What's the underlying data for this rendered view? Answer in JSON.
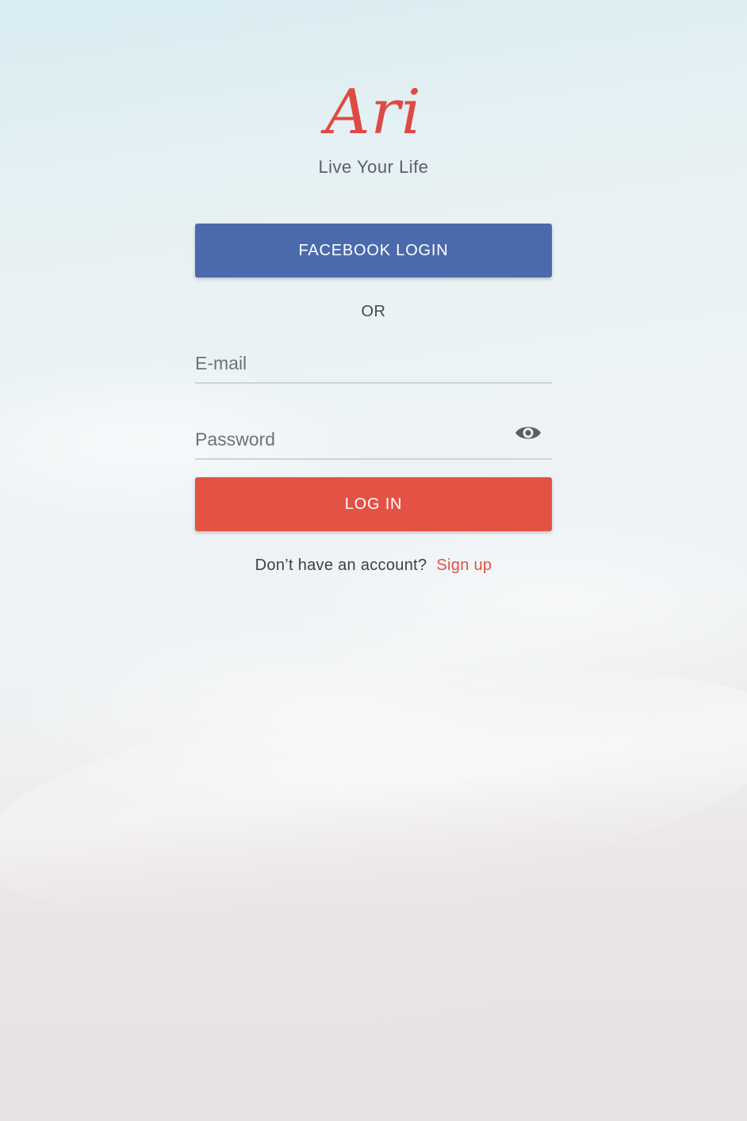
{
  "brand": {
    "logo_text": "Ari",
    "tagline": "Live Your Life",
    "accent_color": "#e35245",
    "facebook_color": "#4a6aac"
  },
  "auth": {
    "facebook_button_label": "FACEBOOK LOGIN",
    "divider_label": "OR",
    "email_placeholder": "E-mail",
    "email_value": "",
    "password_placeholder": "Password",
    "password_value": "",
    "password_toggle_icon": "eye-icon",
    "login_button_label": "LOG IN",
    "signup_prompt": "Don’t have an account?",
    "signup_link_label": "Sign up"
  }
}
